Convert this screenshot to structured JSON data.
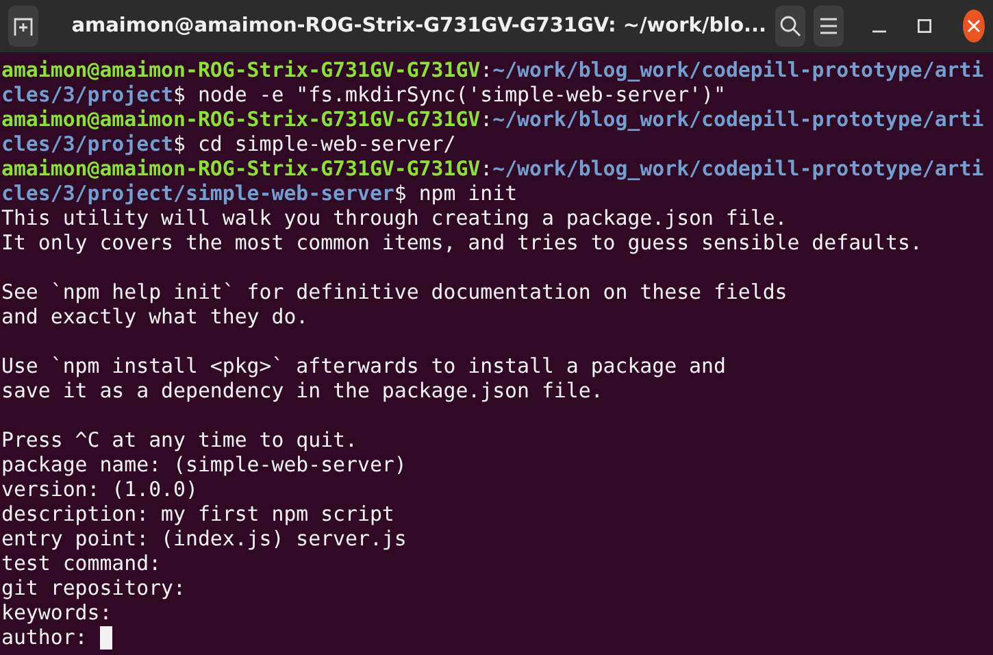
{
  "window": {
    "title": "amaimon@amaimon-ROG-Strix-G731GV-G731GV: ~/work/blo..."
  },
  "terminal": {
    "cursor": true,
    "lines": [
      {
        "kind": "text",
        "segments": [
          {
            "kind": "user",
            "text": "amaimon@amaimon-ROG-Strix-G731GV-G731GV"
          },
          {
            "kind": "plain",
            "text": ":"
          },
          {
            "kind": "path",
            "text": "~/work/blog_work/codepill-prototype/arti"
          }
        ]
      },
      {
        "kind": "text",
        "segments": [
          {
            "kind": "path",
            "text": "cles/3/project"
          },
          {
            "kind": "plain",
            "text": "$ node -e \"fs.mkdirSync('simple-web-server')\""
          }
        ]
      },
      {
        "kind": "text",
        "segments": [
          {
            "kind": "user",
            "text": "amaimon@amaimon-ROG-Strix-G731GV-G731GV"
          },
          {
            "kind": "plain",
            "text": ":"
          },
          {
            "kind": "path",
            "text": "~/work/blog_work/codepill-prototype/arti"
          }
        ]
      },
      {
        "kind": "text",
        "segments": [
          {
            "kind": "path",
            "text": "cles/3/project"
          },
          {
            "kind": "plain",
            "text": "$ cd simple-web-server/"
          }
        ]
      },
      {
        "kind": "text",
        "segments": [
          {
            "kind": "user",
            "text": "amaimon@amaimon-ROG-Strix-G731GV-G731GV"
          },
          {
            "kind": "plain",
            "text": ":"
          },
          {
            "kind": "path",
            "text": "~/work/blog_work/codepill-prototype/arti"
          }
        ]
      },
      {
        "kind": "text",
        "segments": [
          {
            "kind": "path",
            "text": "cles/3/project/simple-web-server"
          },
          {
            "kind": "plain",
            "text": "$ npm init"
          }
        ]
      },
      {
        "kind": "text",
        "segments": [
          {
            "kind": "plain",
            "text": "This utility will walk you through creating a package.json file."
          }
        ]
      },
      {
        "kind": "text",
        "segments": [
          {
            "kind": "plain",
            "text": "It only covers the most common items, and tries to guess sensible defaults."
          }
        ]
      },
      {
        "kind": "blank"
      },
      {
        "kind": "text",
        "segments": [
          {
            "kind": "plain",
            "text": "See `npm help init` for definitive documentation on these fields"
          }
        ]
      },
      {
        "kind": "text",
        "segments": [
          {
            "kind": "plain",
            "text": "and exactly what they do."
          }
        ]
      },
      {
        "kind": "blank"
      },
      {
        "kind": "text",
        "segments": [
          {
            "kind": "plain",
            "text": "Use `npm install <pkg>` afterwards to install a package and"
          }
        ]
      },
      {
        "kind": "text",
        "segments": [
          {
            "kind": "plain",
            "text": "save it as a dependency in the package.json file."
          }
        ]
      },
      {
        "kind": "blank"
      },
      {
        "kind": "text",
        "segments": [
          {
            "kind": "plain",
            "text": "Press ^C at any time to quit."
          }
        ]
      },
      {
        "kind": "text",
        "segments": [
          {
            "kind": "plain",
            "text": "package name: (simple-web-server)"
          }
        ]
      },
      {
        "kind": "text",
        "segments": [
          {
            "kind": "plain",
            "text": "version: (1.0.0)"
          }
        ]
      },
      {
        "kind": "text",
        "segments": [
          {
            "kind": "plain",
            "text": "description: my first npm script"
          }
        ]
      },
      {
        "kind": "text",
        "segments": [
          {
            "kind": "plain",
            "text": "entry point: (index.js) server.js"
          }
        ]
      },
      {
        "kind": "text",
        "segments": [
          {
            "kind": "plain",
            "text": "test command:"
          }
        ]
      },
      {
        "kind": "text",
        "segments": [
          {
            "kind": "plain",
            "text": "git repository:"
          }
        ]
      },
      {
        "kind": "text",
        "segments": [
          {
            "kind": "plain",
            "text": "keywords:"
          }
        ]
      },
      {
        "kind": "text",
        "segments": [
          {
            "kind": "plain",
            "text": "author:"
          }
        ]
      }
    ]
  }
}
